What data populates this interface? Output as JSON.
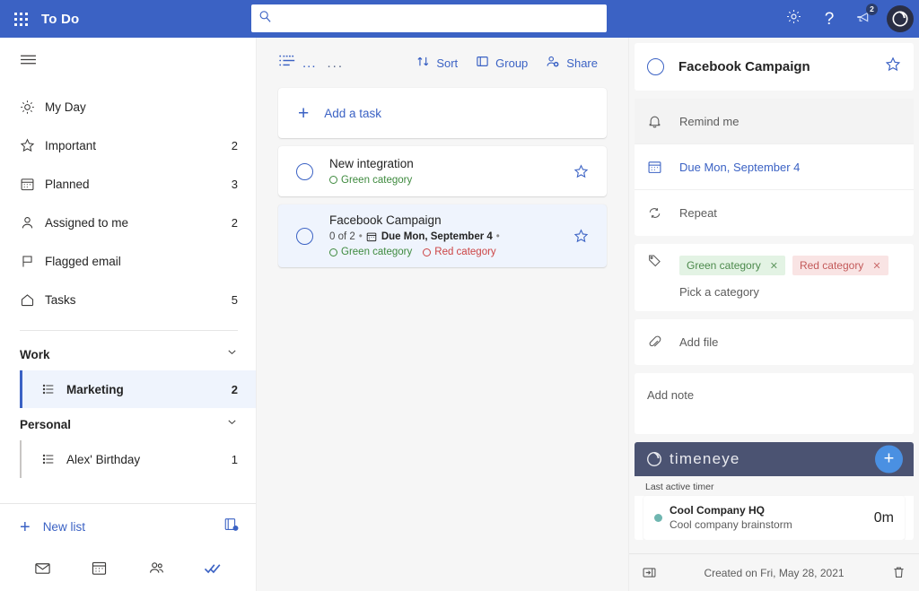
{
  "topbar": {
    "waffle_label": "app-launcher",
    "app_title": "To Do",
    "search_value": "",
    "search_placeholder": "",
    "settings_label": "Settings",
    "help_label": "Help",
    "feedback_badge": "2",
    "avatar_label": "Account manager"
  },
  "sidebar": {
    "menu_label": "Menu",
    "nav": [
      {
        "icon": "sun-icon",
        "label": "My Day",
        "count": ""
      },
      {
        "icon": "star-icon",
        "label": "Important",
        "count": "2"
      },
      {
        "icon": "calendar-icon",
        "label": "Planned",
        "count": "3"
      },
      {
        "icon": "person-icon",
        "label": "Assigned to me",
        "count": "2"
      },
      {
        "icon": "flag-icon",
        "label": "Flagged email",
        "count": ""
      },
      {
        "icon": "home-icon",
        "label": "Tasks",
        "count": "5"
      }
    ],
    "groups": [
      {
        "title": "Work",
        "lists": [
          {
            "label": "Marketing",
            "count": "2",
            "selected": true
          }
        ]
      },
      {
        "title": "Personal",
        "lists": [
          {
            "label": "Alex' Birthday",
            "count": "1",
            "selected": false
          }
        ]
      }
    ],
    "new_list_label": "New list",
    "new_group_label": "new-list-group-icon",
    "bottom_nav": [
      "mail-icon",
      "calendar-icon",
      "people-icon",
      "todo-icon"
    ]
  },
  "center": {
    "toolbar": {
      "list_options_label": "list-options",
      "more_label": "...",
      "sort_label": "Sort",
      "group_label": "Group",
      "share_label": "Share"
    },
    "add_task_label": "Add a task",
    "tasks": [
      {
        "title": "New integration",
        "selected": false,
        "meta": [],
        "categories": [
          {
            "name": "Green category",
            "color": "green"
          }
        ]
      },
      {
        "title": "Facebook Campaign",
        "selected": true,
        "steps": "0 of 2",
        "due": "Due Mon, September 4",
        "categories": [
          {
            "name": "Green category",
            "color": "green"
          },
          {
            "name": "Red category",
            "color": "red"
          }
        ]
      }
    ]
  },
  "detail": {
    "title": "Facebook Campaign",
    "remind_label": "Remind me",
    "due_label": "Due Mon, September 4",
    "repeat_label": "Repeat",
    "categories": [
      {
        "name": "Green category",
        "color": "green",
        "remove": "✕"
      },
      {
        "name": "Red category",
        "color": "red",
        "remove": "✕"
      }
    ],
    "pick_category_label": "Pick a category",
    "add_file_label": "Add file",
    "add_note_placeholder": "Add note",
    "timeneye": {
      "brand": "timeneye",
      "add_label": "+",
      "section_label": "Last active timer",
      "project": "Cool Company HQ",
      "task": "Cool company brainstorm",
      "duration": "0m"
    },
    "footer": {
      "hide_label": "hide-detail-panel",
      "created_text": "Created on Fri, May 28, 2021",
      "delete_label": "delete-task"
    }
  },
  "colors": {
    "brand_blue": "#3b62c4",
    "accent_link": "#3b62c4",
    "selected_bg": "#eff4fd",
    "category_green": "#3e8a3e",
    "category_red": "#c44444",
    "timeneye_header": "#4b5372",
    "timeneye_add": "#4a90e2"
  }
}
